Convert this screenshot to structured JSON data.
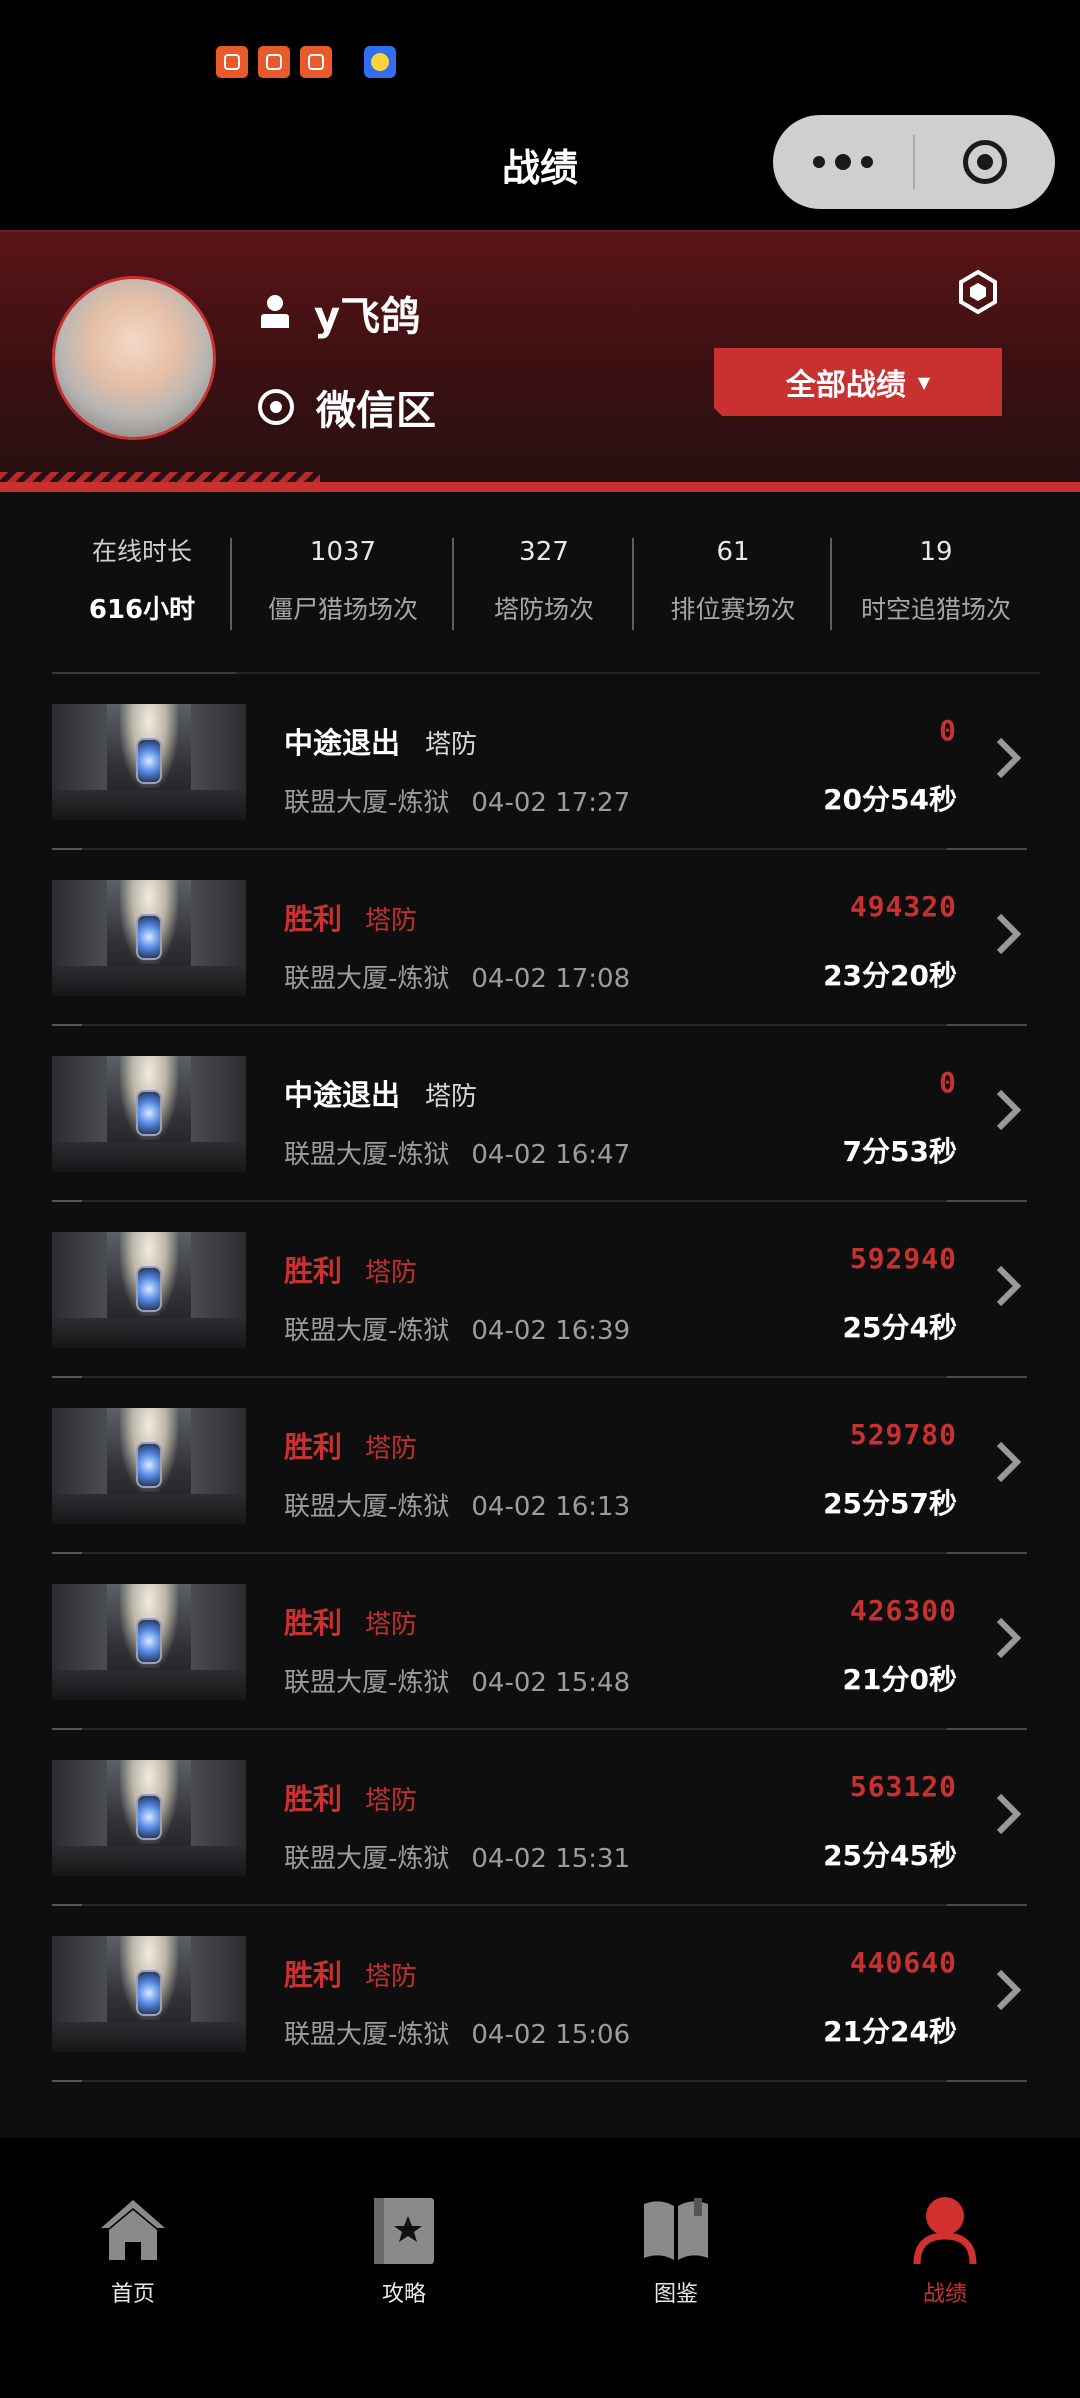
{
  "nav": {
    "title": "战绩"
  },
  "profile": {
    "username": "y飞鸽",
    "region": "微信区",
    "filter_button": "全部战绩",
    "filter_caret": "▼"
  },
  "stats": [
    {
      "value": "616小时",
      "label": "在线时长"
    },
    {
      "value": "1037",
      "label": "僵尸猎场场次"
    },
    {
      "value": "327",
      "label": "塔防场次"
    },
    {
      "value": "61",
      "label": "排位赛场次"
    },
    {
      "value": "19",
      "label": "时空追猎场次"
    }
  ],
  "matches": [
    {
      "result": "中途退出",
      "mode": "塔防",
      "location": "联盟大厦-炼狱",
      "time": "04-02 17:27",
      "score": "0",
      "duration": "20分54秒",
      "win": false
    },
    {
      "result": "胜利",
      "mode": "塔防",
      "location": "联盟大厦-炼狱",
      "time": "04-02 17:08",
      "score": "494320",
      "duration": "23分20秒",
      "win": true
    },
    {
      "result": "中途退出",
      "mode": "塔防",
      "location": "联盟大厦-炼狱",
      "time": "04-02 16:47",
      "score": "0",
      "duration": "7分53秒",
      "win": false
    },
    {
      "result": "胜利",
      "mode": "塔防",
      "location": "联盟大厦-炼狱",
      "time": "04-02 16:39",
      "score": "592940",
      "duration": "25分4秒",
      "win": true
    },
    {
      "result": "胜利",
      "mode": "塔防",
      "location": "联盟大厦-炼狱",
      "time": "04-02 16:13",
      "score": "529780",
      "duration": "25分57秒",
      "win": true
    },
    {
      "result": "胜利",
      "mode": "塔防",
      "location": "联盟大厦-炼狱",
      "time": "04-02 15:48",
      "score": "426300",
      "duration": "21分0秒",
      "win": true
    },
    {
      "result": "胜利",
      "mode": "塔防",
      "location": "联盟大厦-炼狱",
      "time": "04-02 15:31",
      "score": "563120",
      "duration": "25分45秒",
      "win": true
    },
    {
      "result": "胜利",
      "mode": "塔防",
      "location": "联盟大厦-炼狱",
      "time": "04-02 15:06",
      "score": "440640",
      "duration": "21分24秒",
      "win": true
    }
  ],
  "tabs": [
    {
      "label": "首页",
      "icon": "home-icon"
    },
    {
      "label": "攻略",
      "icon": "guide-book-icon"
    },
    {
      "label": "图鉴",
      "icon": "open-book-icon"
    },
    {
      "label": "战绩",
      "icon": "profile-icon"
    }
  ],
  "colors": {
    "accent": "#c8312f",
    "background": "#0e0e0f"
  }
}
